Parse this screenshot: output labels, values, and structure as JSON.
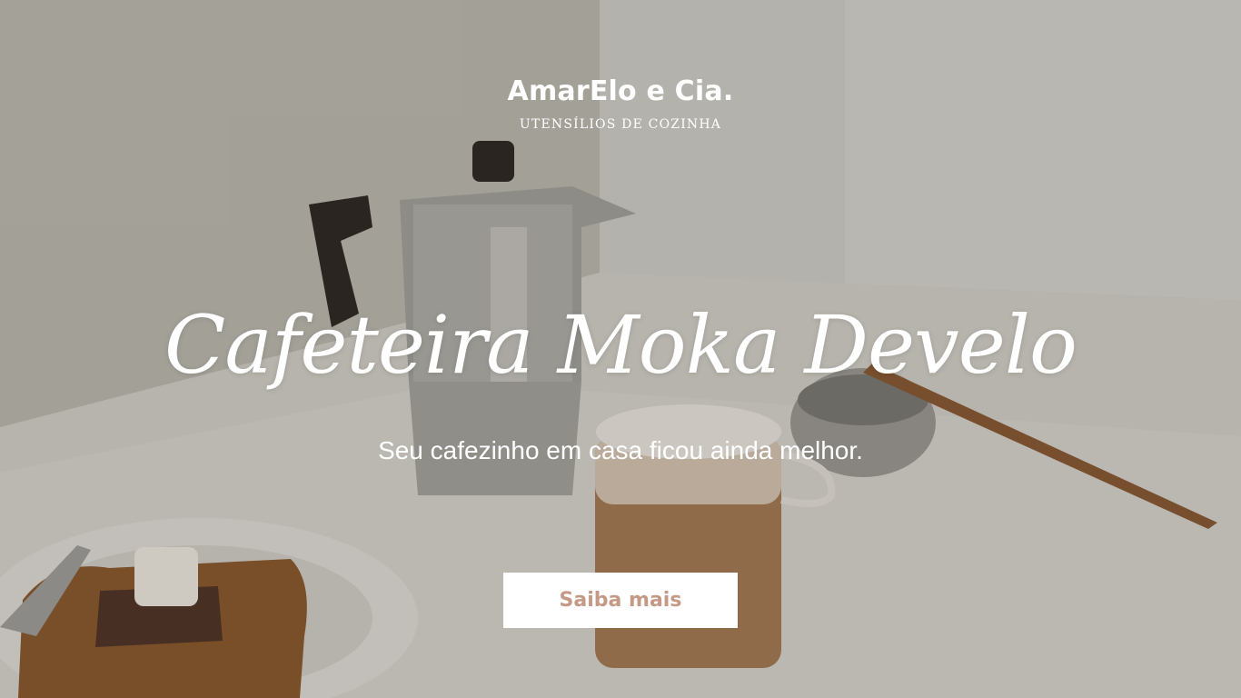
{
  "brand": {
    "name": "AmarElo e Cia.",
    "tagline": "UTENSÍLIOS DE COZINHA"
  },
  "hero": {
    "headline": "Cafeteira Moka Develo",
    "subtitle": "Seu cafezinho em casa ficou ainda melhor.",
    "cta_label": "Saiba mais"
  },
  "colors": {
    "accent": "#c49a86",
    "text": "#ffffff",
    "button_bg": "#ffffff"
  },
  "background": {
    "icons": [
      "moka-pot-icon",
      "coffee-glass-icon",
      "toast-plate-icon",
      "bowl-spoon-icon"
    ]
  }
}
